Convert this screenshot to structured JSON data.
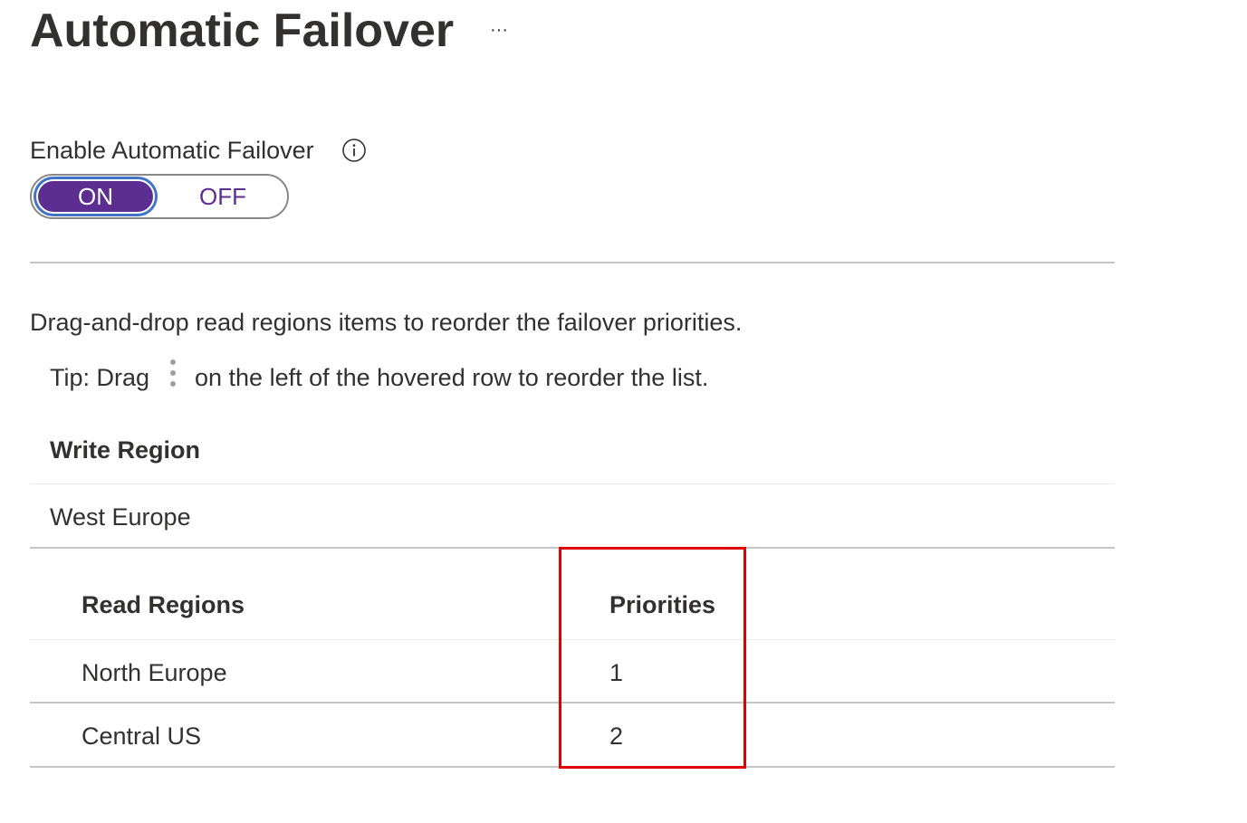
{
  "header": {
    "title": "Automatic Failover",
    "more_label": "···"
  },
  "failover_toggle": {
    "label": "Enable Automatic Failover",
    "on_label": "ON",
    "off_label": "OFF",
    "selected": "ON",
    "info_icon": "info-icon"
  },
  "instructions": {
    "text": "Drag-and-drop read regions items to reorder the failover priorities.",
    "tip_prefix": "Tip: Drag",
    "tip_icon": "drag-handle-icon",
    "tip_suffix": "on the left of the hovered row to reorder the list."
  },
  "write_region": {
    "header": "Write Region",
    "value": "West Europe"
  },
  "read_regions": {
    "headers": {
      "region": "Read Regions",
      "priority": "Priorities"
    },
    "rows": [
      {
        "region": "North Europe",
        "priority": "1"
      },
      {
        "region": "Central US",
        "priority": "2"
      }
    ]
  },
  "colors": {
    "toggle_on_bg": "#5c2e91",
    "toggle_focus_ring": "#4173c6",
    "highlight_border": "#e00000",
    "text": "#323130"
  }
}
